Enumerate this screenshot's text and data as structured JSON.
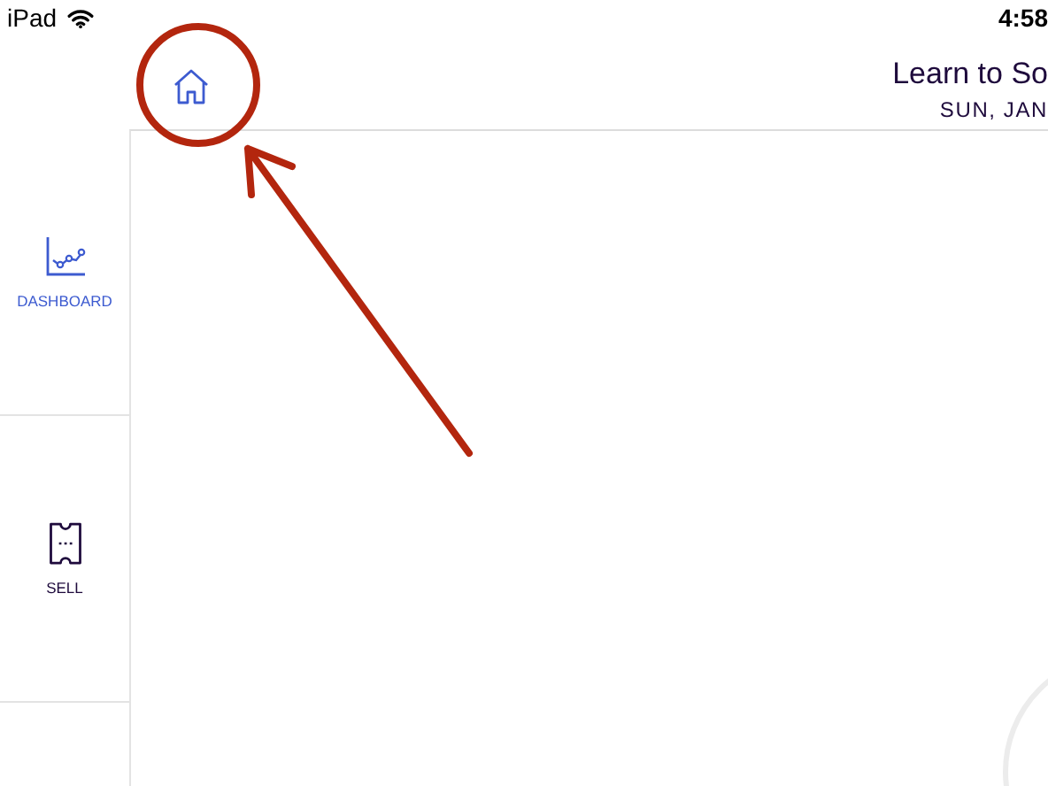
{
  "status_bar": {
    "device": "iPad",
    "time": "4:58"
  },
  "header": {
    "title": "Learn to So",
    "date": "SUN, JAN"
  },
  "sidebar": {
    "items": [
      {
        "label": "DASHBOARD",
        "kind": "chart",
        "selected": true
      },
      {
        "label": "SELL",
        "kind": "ticket",
        "selected": false
      }
    ]
  }
}
